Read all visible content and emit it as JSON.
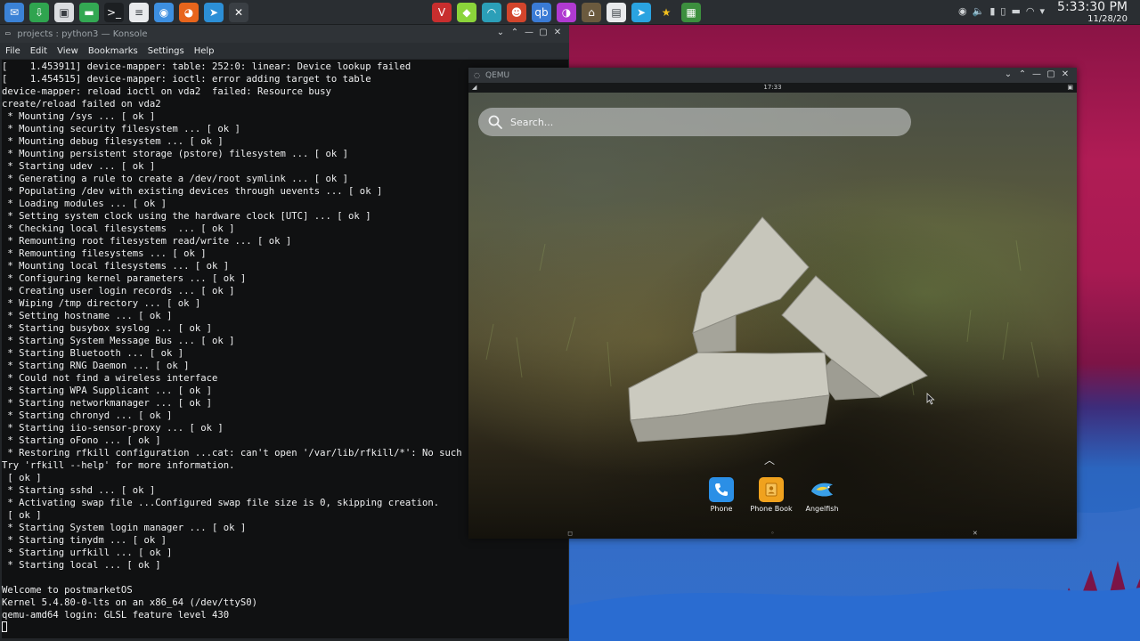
{
  "panel": {
    "launchers": [
      {
        "name": "Mail",
        "icon": "mail-icon",
        "color": "#3b82d6",
        "glyph": "✉"
      },
      {
        "name": "Software Center",
        "icon": "software-center-icon",
        "color": "#2fa44f",
        "glyph": "⇩"
      },
      {
        "name": "Store",
        "icon": "store-bag-icon",
        "color": "#dadde0",
        "glyph": "▣"
      },
      {
        "name": "Files",
        "icon": "folder-icon",
        "color": "#33a853",
        "glyph": "▬"
      },
      {
        "name": "Konsole",
        "icon": "terminal-icon",
        "color": "#1c1f22",
        "glyph": ">_"
      },
      {
        "name": "Notes",
        "icon": "notes-icon",
        "color": "#e8eaec",
        "glyph": "≡"
      },
      {
        "name": "Browser",
        "icon": "browser-icon",
        "color": "#3d8fe0",
        "glyph": "◉"
      },
      {
        "name": "Firefox",
        "icon": "firefox-icon",
        "color": "#e8651c",
        "glyph": "◕"
      },
      {
        "name": "Telegram",
        "icon": "telegram-pin-icon",
        "color": "#2c8fd6",
        "glyph": "➤"
      },
      {
        "name": "Close",
        "icon": "close-icon",
        "color": "#3a3f44",
        "glyph": "✕"
      }
    ],
    "tray_apps": [
      {
        "name": "Vivaldi-like",
        "icon": "viva-icon",
        "color": "#c82e2e",
        "glyph": "V"
      },
      {
        "name": "Cube",
        "icon": "cube-icon",
        "color": "#8bd43a",
        "glyph": "◆"
      },
      {
        "name": "Gauge",
        "icon": "gauge-icon",
        "color": "#2b9fb8",
        "glyph": "◠"
      },
      {
        "name": "Robot",
        "icon": "robot-icon",
        "color": "#d2452c",
        "glyph": "☻"
      },
      {
        "name": "qBittorrent",
        "icon": "qbittorrent-icon",
        "color": "#3a7bd5",
        "glyph": "qb"
      },
      {
        "name": "Color Picker",
        "icon": "color-wheel-icon",
        "color": "#b03ad1",
        "glyph": "◑"
      },
      {
        "name": "GIMP",
        "icon": "gimp-icon",
        "color": "#6b5a3e",
        "glyph": "⌂"
      },
      {
        "name": "Document",
        "icon": "document-icon",
        "color": "#e9ebed",
        "glyph": "▤"
      },
      {
        "name": "Telegram",
        "icon": "telegram-icon",
        "color": "#2aa3e0",
        "glyph": "➤"
      },
      {
        "name": "Favorites",
        "icon": "star-icon",
        "color": "#2a2e32",
        "glyph": "★"
      },
      {
        "name": "Calculator",
        "icon": "calculator-icon",
        "color": "#3c8f3e",
        "glyph": "▦"
      }
    ],
    "systray": [
      {
        "icon": "record-icon",
        "glyph": "◉"
      },
      {
        "icon": "volume-icon",
        "glyph": "🔈"
      },
      {
        "icon": "battery-icon",
        "glyph": "▮"
      },
      {
        "icon": "clipboard-icon",
        "glyph": "▯"
      },
      {
        "icon": "us-flag-icon",
        "glyph": "▬"
      },
      {
        "icon": "wifi-icon",
        "glyph": "◠"
      },
      {
        "icon": "chevron-down-icon",
        "glyph": "▾"
      }
    ],
    "clock_time": "5:33:30 PM",
    "clock_date": "11/28/20"
  },
  "konsole": {
    "title": "projects : python3 — Konsole",
    "menu": [
      "File",
      "Edit",
      "View",
      "Bookmarks",
      "Settings",
      "Help"
    ],
    "lines": [
      "[    1.453911] device-mapper: table: 252:0: linear: Device lookup failed",
      "[    1.454515] device-mapper: ioctl: error adding target to table",
      "device-mapper: reload ioctl on vda2  failed: Resource busy",
      "create/reload failed on vda2",
      " * Mounting /sys ... [ ok ]",
      " * Mounting security filesystem ... [ ok ]",
      " * Mounting debug filesystem ... [ ok ]",
      " * Mounting persistent storage (pstore) filesystem ... [ ok ]",
      " * Starting udev ... [ ok ]",
      " * Generating a rule to create a /dev/root symlink ... [ ok ]",
      " * Populating /dev with existing devices through uevents ... [ ok ]",
      " * Loading modules ... [ ok ]",
      " * Setting system clock using the hardware clock [UTC] ... [ ok ]",
      " * Checking local filesystems  ... [ ok ]",
      " * Remounting root filesystem read/write ... [ ok ]",
      " * Remounting filesystems ... [ ok ]",
      " * Mounting local filesystems ... [ ok ]",
      " * Configuring kernel parameters ... [ ok ]",
      " * Creating user login records ... [ ok ]",
      " * Wiping /tmp directory ... [ ok ]",
      " * Setting hostname ... [ ok ]",
      " * Starting busybox syslog ... [ ok ]",
      " * Starting System Message Bus ... [ ok ]",
      " * Starting Bluetooth ... [ ok ]",
      " * Starting RNG Daemon ... [ ok ]",
      " * Could not find a wireless interface",
      " * Starting WPA Supplicant ... [ ok ]",
      " * Starting networkmanager ... [ ok ]",
      " * Starting chronyd ... [ ok ]",
      " * Starting iio-sensor-proxy ... [ ok ]",
      " * Starting oFono ... [ ok ]",
      " * Restoring rfkill configuration ...cat: can't open '/var/lib/rfkill/*': No such file",
      "Try 'rfkill --help' for more information.",
      " [ ok ]",
      " * Starting sshd ... [ ok ]",
      " * Activating swap file ...Configured swap file size is 0, skipping creation.",
      " [ ok ]",
      " * Starting System login manager ... [ ok ]",
      " * Starting tinydm ... [ ok ]",
      " * Starting urfkill ... [ ok ]",
      " * Starting local ... [ ok ]",
      "",
      "Welcome to postmarketOS",
      "Kernel 5.4.80-0-lts on an x86_64 (/dev/ttyS0)",
      "qemu-amd64 login: GLSL feature level 430"
    ]
  },
  "qemu": {
    "title": "QEMU",
    "status_time": "17:33",
    "search_placeholder": "Search...",
    "apps": [
      {
        "label": "Phone",
        "icon": "phone-icon",
        "color": "#2b8fe6"
      },
      {
        "label": "Phone Book",
        "icon": "phone-book-icon",
        "color": "#f0a21e"
      },
      {
        "label": "Angelfish",
        "icon": "angelfish-icon",
        "color": "#3aa0e8"
      }
    ]
  }
}
